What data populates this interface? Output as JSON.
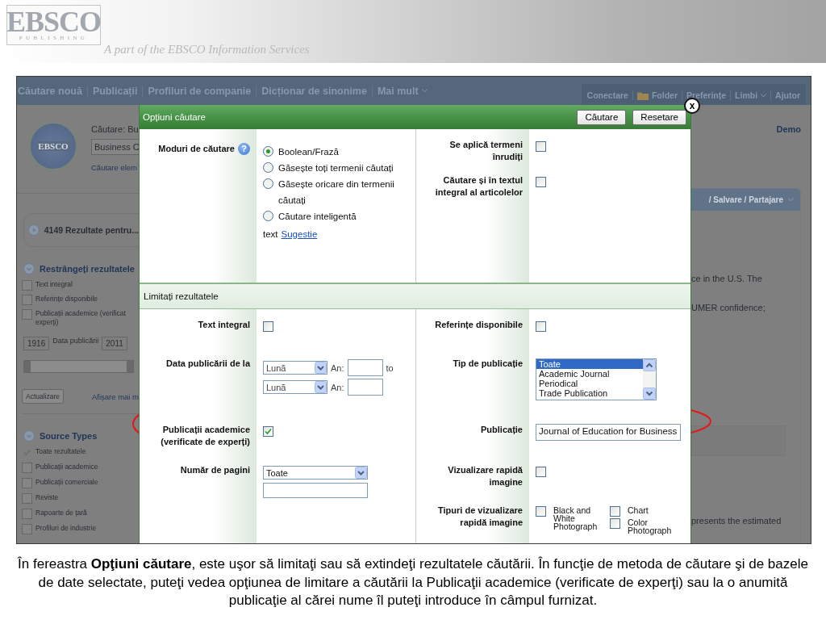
{
  "slide_header": {
    "logo": "EBSCO",
    "logo_subtitle": "PUBLISHING",
    "tagline": "A part of the EBSCO Information Services"
  },
  "nav": {
    "items": [
      {
        "label": "Căutare nouă",
        "kind": "link"
      },
      {
        "label": "Publicații",
        "kind": "link"
      },
      {
        "label": "Profiluri de companie",
        "kind": "link"
      },
      {
        "label": "Dicționar de sinonime",
        "kind": "link"
      },
      {
        "label": "Mai mult",
        "kind": "menu"
      }
    ],
    "tools": [
      {
        "label": "Conectare",
        "kind": "link"
      },
      {
        "label": "Folder",
        "kind": "folder"
      },
      {
        "label": "Preferințe",
        "kind": "link"
      },
      {
        "label": "Limbi",
        "kind": "menu"
      },
      {
        "label": "Ajutor",
        "kind": "link"
      }
    ]
  },
  "background_left": {
    "logo": "EBSCO",
    "search_label": "Căutare: Bu",
    "search_value": "Business C",
    "advanced_link": "Căutare elem",
    "results": "4149 Rezultate pentru...",
    "refine_title": "Restrângeți rezultatele",
    "refine_options": [
      {
        "lines": [
          "Text integral"
        ],
        "checked": false
      },
      {
        "lines": [
          "Referințe disponibile"
        ],
        "checked": false
      },
      {
        "lines": [
          "Publicații academice (verificat",
          "experți)"
        ],
        "checked": false
      }
    ],
    "date_from": "1916",
    "date_label": "Data publicării",
    "date_to": "2011",
    "date_slider": {
      "level": 1
    },
    "update_button": "Actualizare",
    "more_link": "Afișare mai m",
    "source_title": "Source Types",
    "source_options": [
      {
        "label": "Toate rezultatele",
        "checked": true
      },
      {
        "label": "Publicații academice",
        "checked": false
      },
      {
        "label": "Publicații comerciale",
        "checked": false
      },
      {
        "label": "Reviste",
        "checked": false
      },
      {
        "label": "Rapoarte de țară",
        "checked": false
      },
      {
        "label": "Profiluri de industrie",
        "checked": false
      }
    ]
  },
  "modal": {
    "title": "Opțiuni căutare",
    "buttons": [
      "Căutare",
      "Resetare"
    ],
    "close": "x",
    "search_modes": {
      "label": "Moduri de căutare",
      "help": "?",
      "options": [
        {
          "label": "Boolean/Frază",
          "selected": true
        },
        {
          "label": "Găsește toți termenii căutați",
          "selected": false
        },
        {
          "label": "Găsește oricare din termenii căutați",
          "selected": false
        },
        {
          "label": "Căutare inteligentă",
          "selected": false
        }
      ],
      "hint_text": "text",
      "hint_link": "Sugestie"
    },
    "expanders": [
      {
        "label": "Se aplică termeni înrudiți",
        "checked": false
      },
      {
        "label": "Căutare și în textul integral al articolelor",
        "checked": false
      }
    ],
    "limits_title": "Limitați rezultatele",
    "limit_rows": [
      {
        "left": {
          "kind": "checkbox",
          "label": "Text integral",
          "checked": false
        },
        "right": {
          "kind": "checkbox",
          "label": "Referințe disponibile",
          "checked": false
        }
      },
      {
        "left": {
          "kind": "date_range",
          "label": "Data publicării de la",
          "lines": [
            {
              "month": "Lună",
              "year_label": "An:"
            },
            {
              "month": "Lună",
              "year_label": "An:"
            }
          ],
          "to": "to"
        },
        "right": {
          "kind": "listbox",
          "label": "Tip de publicație",
          "options": [
            {
              "label": "Toate",
              "selected": true
            },
            {
              "label": "Academic Journal",
              "selected": false
            },
            {
              "label": "Periodical",
              "selected": false
            },
            {
              "label": "Trade Publication",
              "selected": false
            }
          ]
        }
      },
      {
        "left": {
          "kind": "checkbox",
          "label": "Publicații academice (verificate de experți)",
          "checked": true
        },
        "right": {
          "kind": "text_input",
          "label": "Publicație",
          "value": "Journal of Education for Business"
        }
      },
      {
        "left": {
          "kind": "select",
          "label": "Număr de pagini",
          "value": "Toate"
        },
        "right": {
          "kind": "checkbox",
          "label": "Vizualizare rapidă imagine",
          "checked": false
        }
      },
      {
        "right": {
          "kind": "checkbox_group",
          "label": "Tipuri de vizualizare rapidă imagine",
          "options": [
            {
              "label": "Black and White Photograph",
              "checked": false
            },
            {
              "label": "Chart",
              "checked": false
            },
            {
              "label": "Color Photograph",
              "checked": false
            }
          ]
        }
      }
    ]
  },
  "background_right": {
    "user": "Demo",
    "tab": "/ Salvare / Partajare",
    "snippets_top": [
      "ce in the U.S. The",
      "UMER confidence;"
    ],
    "snippet_bottom": "presents the estimated"
  },
  "caption": "În fereastra **Opţiuni căutare**, este uşor să limitaţi sau să extindeţi rezultatele căutării. În funcţie de metoda de căutare şi de bazele de date selectate, puteţi vedea opţiunea de limitare a căutării la Publicaţii academice (verificate de experţi) sau la o anumită publicaţie al cărei nume îl puteţi introduce în câmpul furnizat."
}
